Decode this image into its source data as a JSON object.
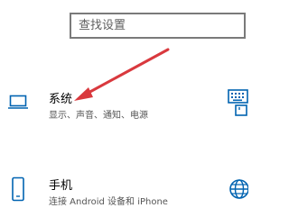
{
  "search": {
    "placeholder": "查找设置"
  },
  "tiles": [
    {
      "title": "系统",
      "description": "显示、声音、通知、电源",
      "icon": "laptop-icon"
    },
    {
      "title": "手机",
      "description": "连接 Android 设备和 iPhone",
      "icon": "phone-icon"
    },
    {
      "title": "",
      "description": "",
      "icon": "keyboard-icon"
    },
    {
      "title": "",
      "description": "",
      "icon": "globe-icon"
    }
  ],
  "colors": {
    "accent": "#0063b1",
    "annotation_arrow": "#d9393e",
    "search_border": "#7a7a7a",
    "description_text": "#555555"
  }
}
